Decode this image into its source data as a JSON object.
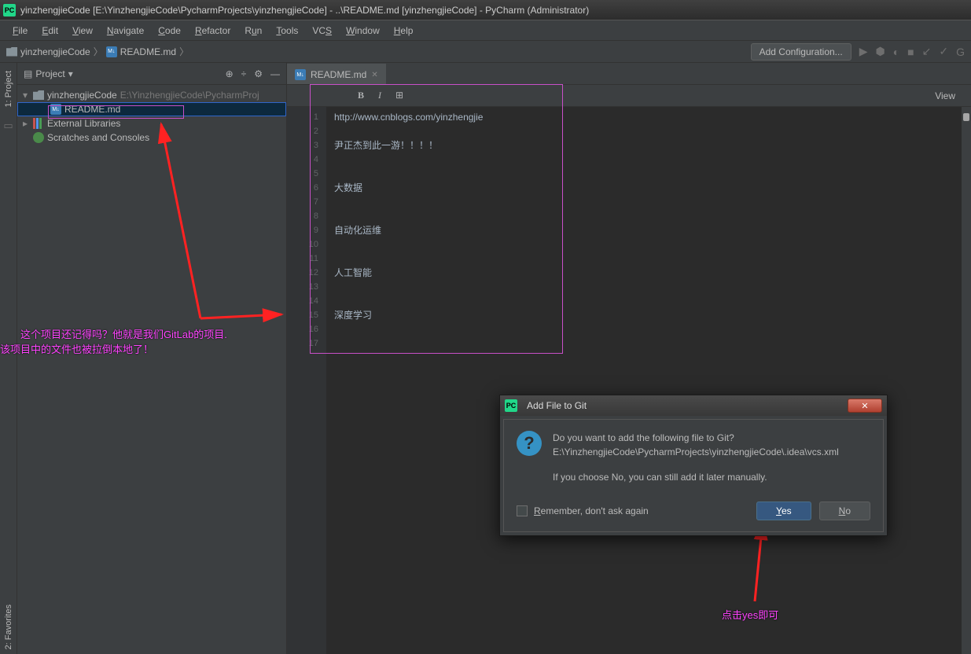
{
  "window": {
    "title": "yinzhengjieCode [E:\\YinzhengjieCode\\PycharmProjects\\yinzhengjieCode] - ..\\README.md [yinzhengjieCode] - PyCharm (Administrator)"
  },
  "menu": {
    "file": "File",
    "edit": "Edit",
    "view": "View",
    "navigate": "Navigate",
    "code": "Code",
    "refactor": "Refactor",
    "run": "Run",
    "tools": "Tools",
    "vcs": "VCS",
    "window": "Window",
    "help": "Help"
  },
  "breadcrumb": {
    "project": "yinzhengjieCode",
    "file": "README.md"
  },
  "toolbar": {
    "add_config": "Add Configuration...",
    "view_label": "View"
  },
  "project_panel": {
    "title": "Project",
    "root": "yinzhengjieCode",
    "root_path": "E:\\YinzhengjieCode\\PycharmProj",
    "file1": "README.md",
    "external": "External Libraries",
    "scratches": "Scratches and Consoles"
  },
  "left_rail": {
    "project": "1: Project",
    "favorites": "2: Favorites"
  },
  "tab": {
    "name": "README.md"
  },
  "editor": {
    "lines": {
      "l1": "http://www.cnblogs.com/yinzhengjie",
      "l3": "尹正杰到此一游！！！！",
      "l6": "大数据",
      "l9": "自动化运维",
      "l12": "人工智能",
      "l15": "深度学习"
    },
    "gutter": [
      "1",
      "2",
      "3",
      "4",
      "5",
      "6",
      "7",
      "8",
      "9",
      "10",
      "11",
      "12",
      "13",
      "14",
      "15",
      "16",
      "17"
    ]
  },
  "dialog": {
    "title": "Add File to Git",
    "line1": "Do you want to add the following file to Git?",
    "line2": "E:\\YinzhengjieCode\\PycharmProjects\\yinzhengjieCode\\.idea\\vcs.xml",
    "line3": "If you choose No, you can still add it later manually.",
    "remember": "Remember, don't ask again",
    "yes": "Yes",
    "no": "No"
  },
  "annotations": {
    "a1_l1": "这个项目还记得吗？他就是我们GitLab的项目.",
    "a1_l2": "该项目中的文件也被拉倒本地了！",
    "a2": "点击yes即可"
  }
}
